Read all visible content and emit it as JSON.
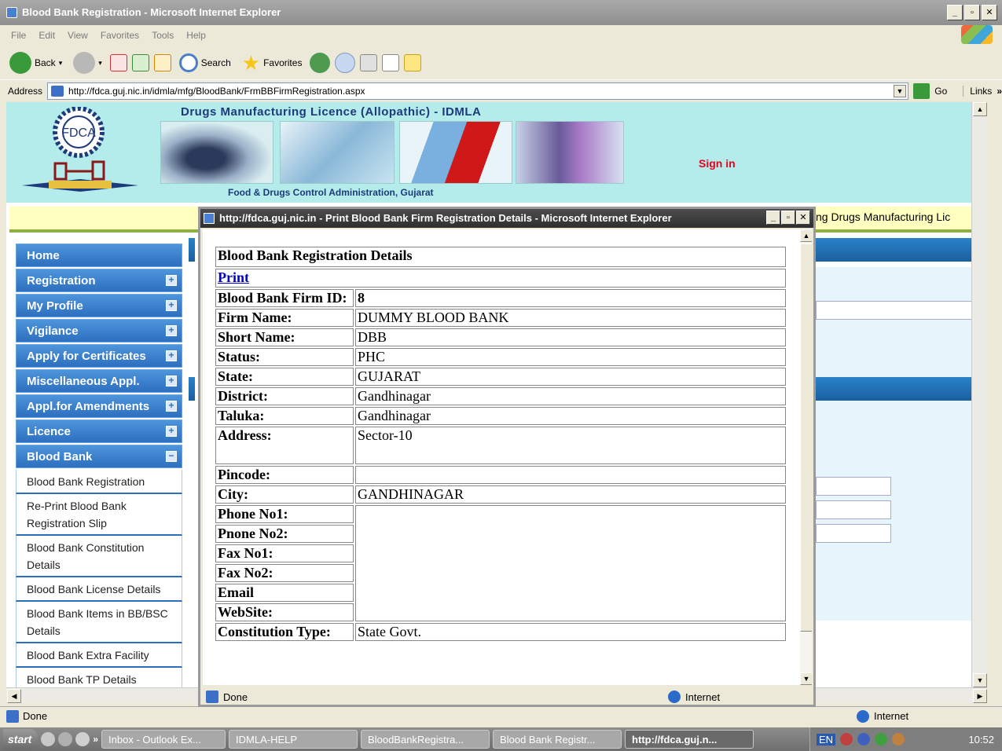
{
  "browser": {
    "title": "Blood Bank Registration - Microsoft Internet Explorer",
    "menu": [
      "File",
      "Edit",
      "View",
      "Favorites",
      "Tools",
      "Help"
    ],
    "toolbar": {
      "back": "Back",
      "search": "Search",
      "favorites": "Favorites"
    },
    "address_label": "Address",
    "url": "http://fdca.guj.nic.in/idmla/mfg/BloodBank/FrmBBFirmRegistration.aspx",
    "go": "Go",
    "links": "Links",
    "status": "Done",
    "zone": "Internet"
  },
  "site": {
    "title": "Drugs Manufacturing Licence (Allopathic) - IDMLA",
    "subtitle": "Food & Drugs Control Administration, Gujarat",
    "logo_text": "FDCA",
    "sign_in": "Sign in",
    "marquee": "ng Drugs Manufacturing Lic"
  },
  "sidebar": {
    "headers": [
      {
        "label": "Home",
        "toggle": ""
      },
      {
        "label": "Registration",
        "toggle": "+"
      },
      {
        "label": "My Profile",
        "toggle": "+"
      },
      {
        "label": "Vigilance",
        "toggle": "+"
      },
      {
        "label": "Apply for Certificates",
        "toggle": "+"
      },
      {
        "label": "Miscellaneous Appl.",
        "toggle": "+"
      },
      {
        "label": "Appl.for Amendments",
        "toggle": "+"
      },
      {
        "label": "Licence",
        "toggle": "+"
      },
      {
        "label": "Blood Bank",
        "toggle": "−"
      }
    ],
    "items": [
      "Blood Bank Registration",
      "Re-Print Blood Bank Registration Slip",
      "Blood Bank Constitution Details",
      "Blood Bank License Details",
      "Blood Bank Items in BB/BSC Details",
      "Blood Bank Extra Facility",
      "Blood Bank TP Details"
    ]
  },
  "popup": {
    "title": "http://fdca.guj.nic.in - Print Blood Bank Firm Registration Details - Microsoft Internet Explorer",
    "heading": "Blood Bank Registration Details",
    "print": "Print",
    "fields": [
      {
        "label": "Blood Bank Firm ID:",
        "value": "8"
      },
      {
        "label": "Firm Name:",
        "value": "DUMMY BLOOD BANK"
      },
      {
        "label": "Short Name:",
        "value": "DBB"
      },
      {
        "label": "Status:",
        "value": "PHC"
      },
      {
        "label": "State:",
        "value": "GUJARAT"
      },
      {
        "label": "District:",
        "value": "Gandhinagar"
      },
      {
        "label": "Taluka:",
        "value": "Gandhinagar"
      },
      {
        "label": "Address:",
        "value": "Sector-10"
      },
      {
        "label": "Pincode:",
        "value": ""
      },
      {
        "label": "City:",
        "value": "GANDHINAGAR"
      },
      {
        "label": "Phone No1:",
        "value": ""
      },
      {
        "label": "Pnone No2:",
        "value": ""
      },
      {
        "label": "Fax No1:",
        "value": ""
      },
      {
        "label": "Fax No2:",
        "value": ""
      },
      {
        "label": "Email",
        "value": ""
      },
      {
        "label": "WebSite:",
        "value": ""
      },
      {
        "label": "Constitution Type:",
        "value": "State Govt."
      }
    ],
    "status": "Done",
    "zone": "Internet"
  },
  "taskbar": {
    "start": "start",
    "tasks": [
      "Inbox - Outlook Ex...",
      "IDMLA-HELP",
      "BloodBankRegistra...",
      "Blood Bank Registr...",
      "http://fdca.guj.n..."
    ],
    "lang": "EN",
    "clock": "10:52"
  }
}
